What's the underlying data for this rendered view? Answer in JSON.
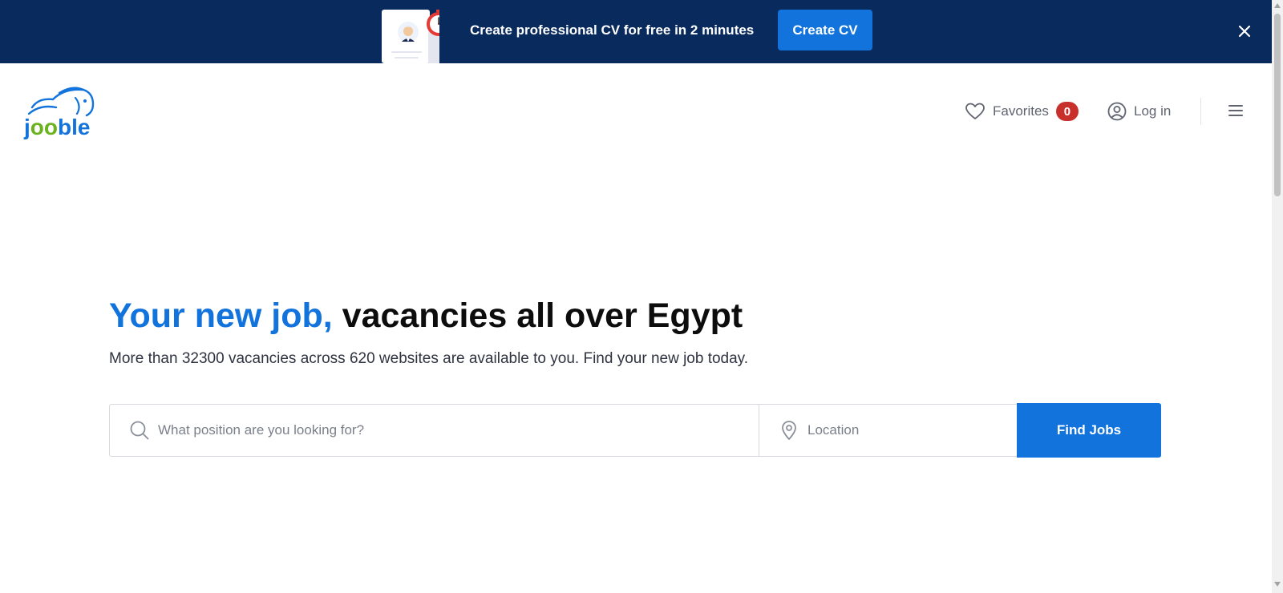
{
  "promo": {
    "text": "Create professional CV for free in 2 minutes",
    "button_label": "Create CV"
  },
  "header": {
    "logo_text": "jooble",
    "favorites_label": "Favorites",
    "favorites_count": "0",
    "login_label": "Log in"
  },
  "hero": {
    "title_accent": "Your new job,",
    "title_rest": " vacancies all over Egypt",
    "subtitle": "More than 32300 vacancies across 620 websites are available to you. Find your new job today."
  },
  "search": {
    "position_placeholder": "What position are you looking for?",
    "location_placeholder": "Location",
    "button_label": "Find Jobs"
  },
  "colors": {
    "banner_bg": "#092a5c",
    "accent_blue": "#1173db",
    "badge_red": "#c8302c",
    "logo_green": "#6ab31e"
  },
  "icons": {
    "promo_close": "close-icon",
    "favorites": "heart-icon",
    "login": "user-circle-icon",
    "menu": "hamburger-menu-icon",
    "search": "search-icon",
    "location": "map-pin-icon",
    "promo_art": "cv-stopwatch-illustration"
  }
}
